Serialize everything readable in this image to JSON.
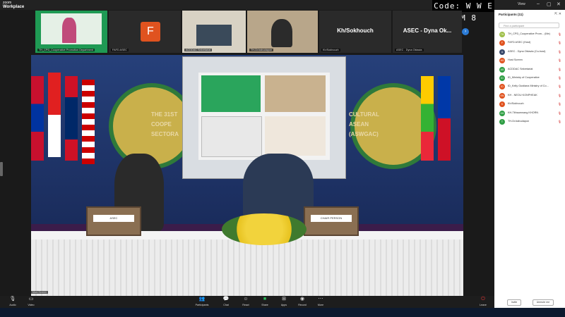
{
  "app": {
    "brand_small": "zoom",
    "brand_name": "Workplace"
  },
  "overlay": {
    "code": "Code: W W E U M 8"
  },
  "window": {
    "view_label": "View",
    "minimize": "–",
    "maximize": "▢",
    "close": "✕"
  },
  "gallery": {
    "tiles": [
      {
        "label": "TH_CPD_Cooperative Promotion Department"
      },
      {
        "label": "FAFD ASEC",
        "avatar_letter": "F"
      },
      {
        "label": "ACDDAC Sekretariat"
      },
      {
        "label": "TH-Dr.babudapon"
      },
      {
        "label": "Kh/Sokhouch",
        "name": "Kh/Sokhouch"
      },
      {
        "label": "ASEC - Dyna Oktavia",
        "name": "ASEC - Dyna Ok..."
      }
    ],
    "next_icon": "chevron-right-icon"
  },
  "main_video": {
    "banner_lines": [
      "THE 31ST",
      "COOPE",
      "SECTORA",
      "CULTURAL",
      "ASEAN",
      "(ASWGAC)"
    ],
    "nameplates": [
      "ASEC",
      "CHAIR PERSON"
    ],
    "self_label": "Main Screen"
  },
  "colors": {
    "accent": "#2b7bd6",
    "mute_red": "#d02020",
    "avatar_orange": "#e0531f"
  },
  "participants": {
    "title": "Participants (11)",
    "search_placeholder": "Find a participant",
    "list": [
      {
        "initials": "TH",
        "name": "TH_CPD_Cooperative Prom... (Me)",
        "color": "#9fbf4a"
      },
      {
        "initials": "F",
        "name": "FAFD ASEC (Host)",
        "color": "#e0531f"
      },
      {
        "initials": "A",
        "name": "ASEC - Dyna Oktavia (Co-host)",
        "color": "#3b4a6b"
      },
      {
        "initials": "HS",
        "name": "Host Screen",
        "color": "#e0531f"
      },
      {
        "initials": "AS",
        "name": "ACDDAC Sekretariat",
        "color": "#2f9e44"
      },
      {
        "initials": "ID",
        "name": "ID_Ministry of Cooperative",
        "color": "#2f9e44"
      },
      {
        "initials": "ID",
        "name": "ID_Kelly Gustiana Ministry of Co...",
        "color": "#e0531f"
      },
      {
        "initials": "KN",
        "name": "KH - NEOU KONPHEAK",
        "color": "#e0531f"
      },
      {
        "initials": "K",
        "name": "Kh/Sokhouch",
        "color": "#e0531f"
      },
      {
        "initials": "KH",
        "name": "KH-Tithsamnang KHORN",
        "color": "#2f9e44"
      },
      {
        "initials": "T",
        "name": "TH-Dr.babudapon",
        "color": "#2f9e44"
      }
    ],
    "invite_label": "Invite",
    "unmute_all_label": "Unmute me"
  },
  "toolbar": {
    "audio": "Audio",
    "video": "Video",
    "participants": "Participants",
    "chat": "Chat",
    "react": "React",
    "share": "Share",
    "apps": "Apps",
    "record": "Record",
    "more": "More",
    "leave": "Leave"
  }
}
